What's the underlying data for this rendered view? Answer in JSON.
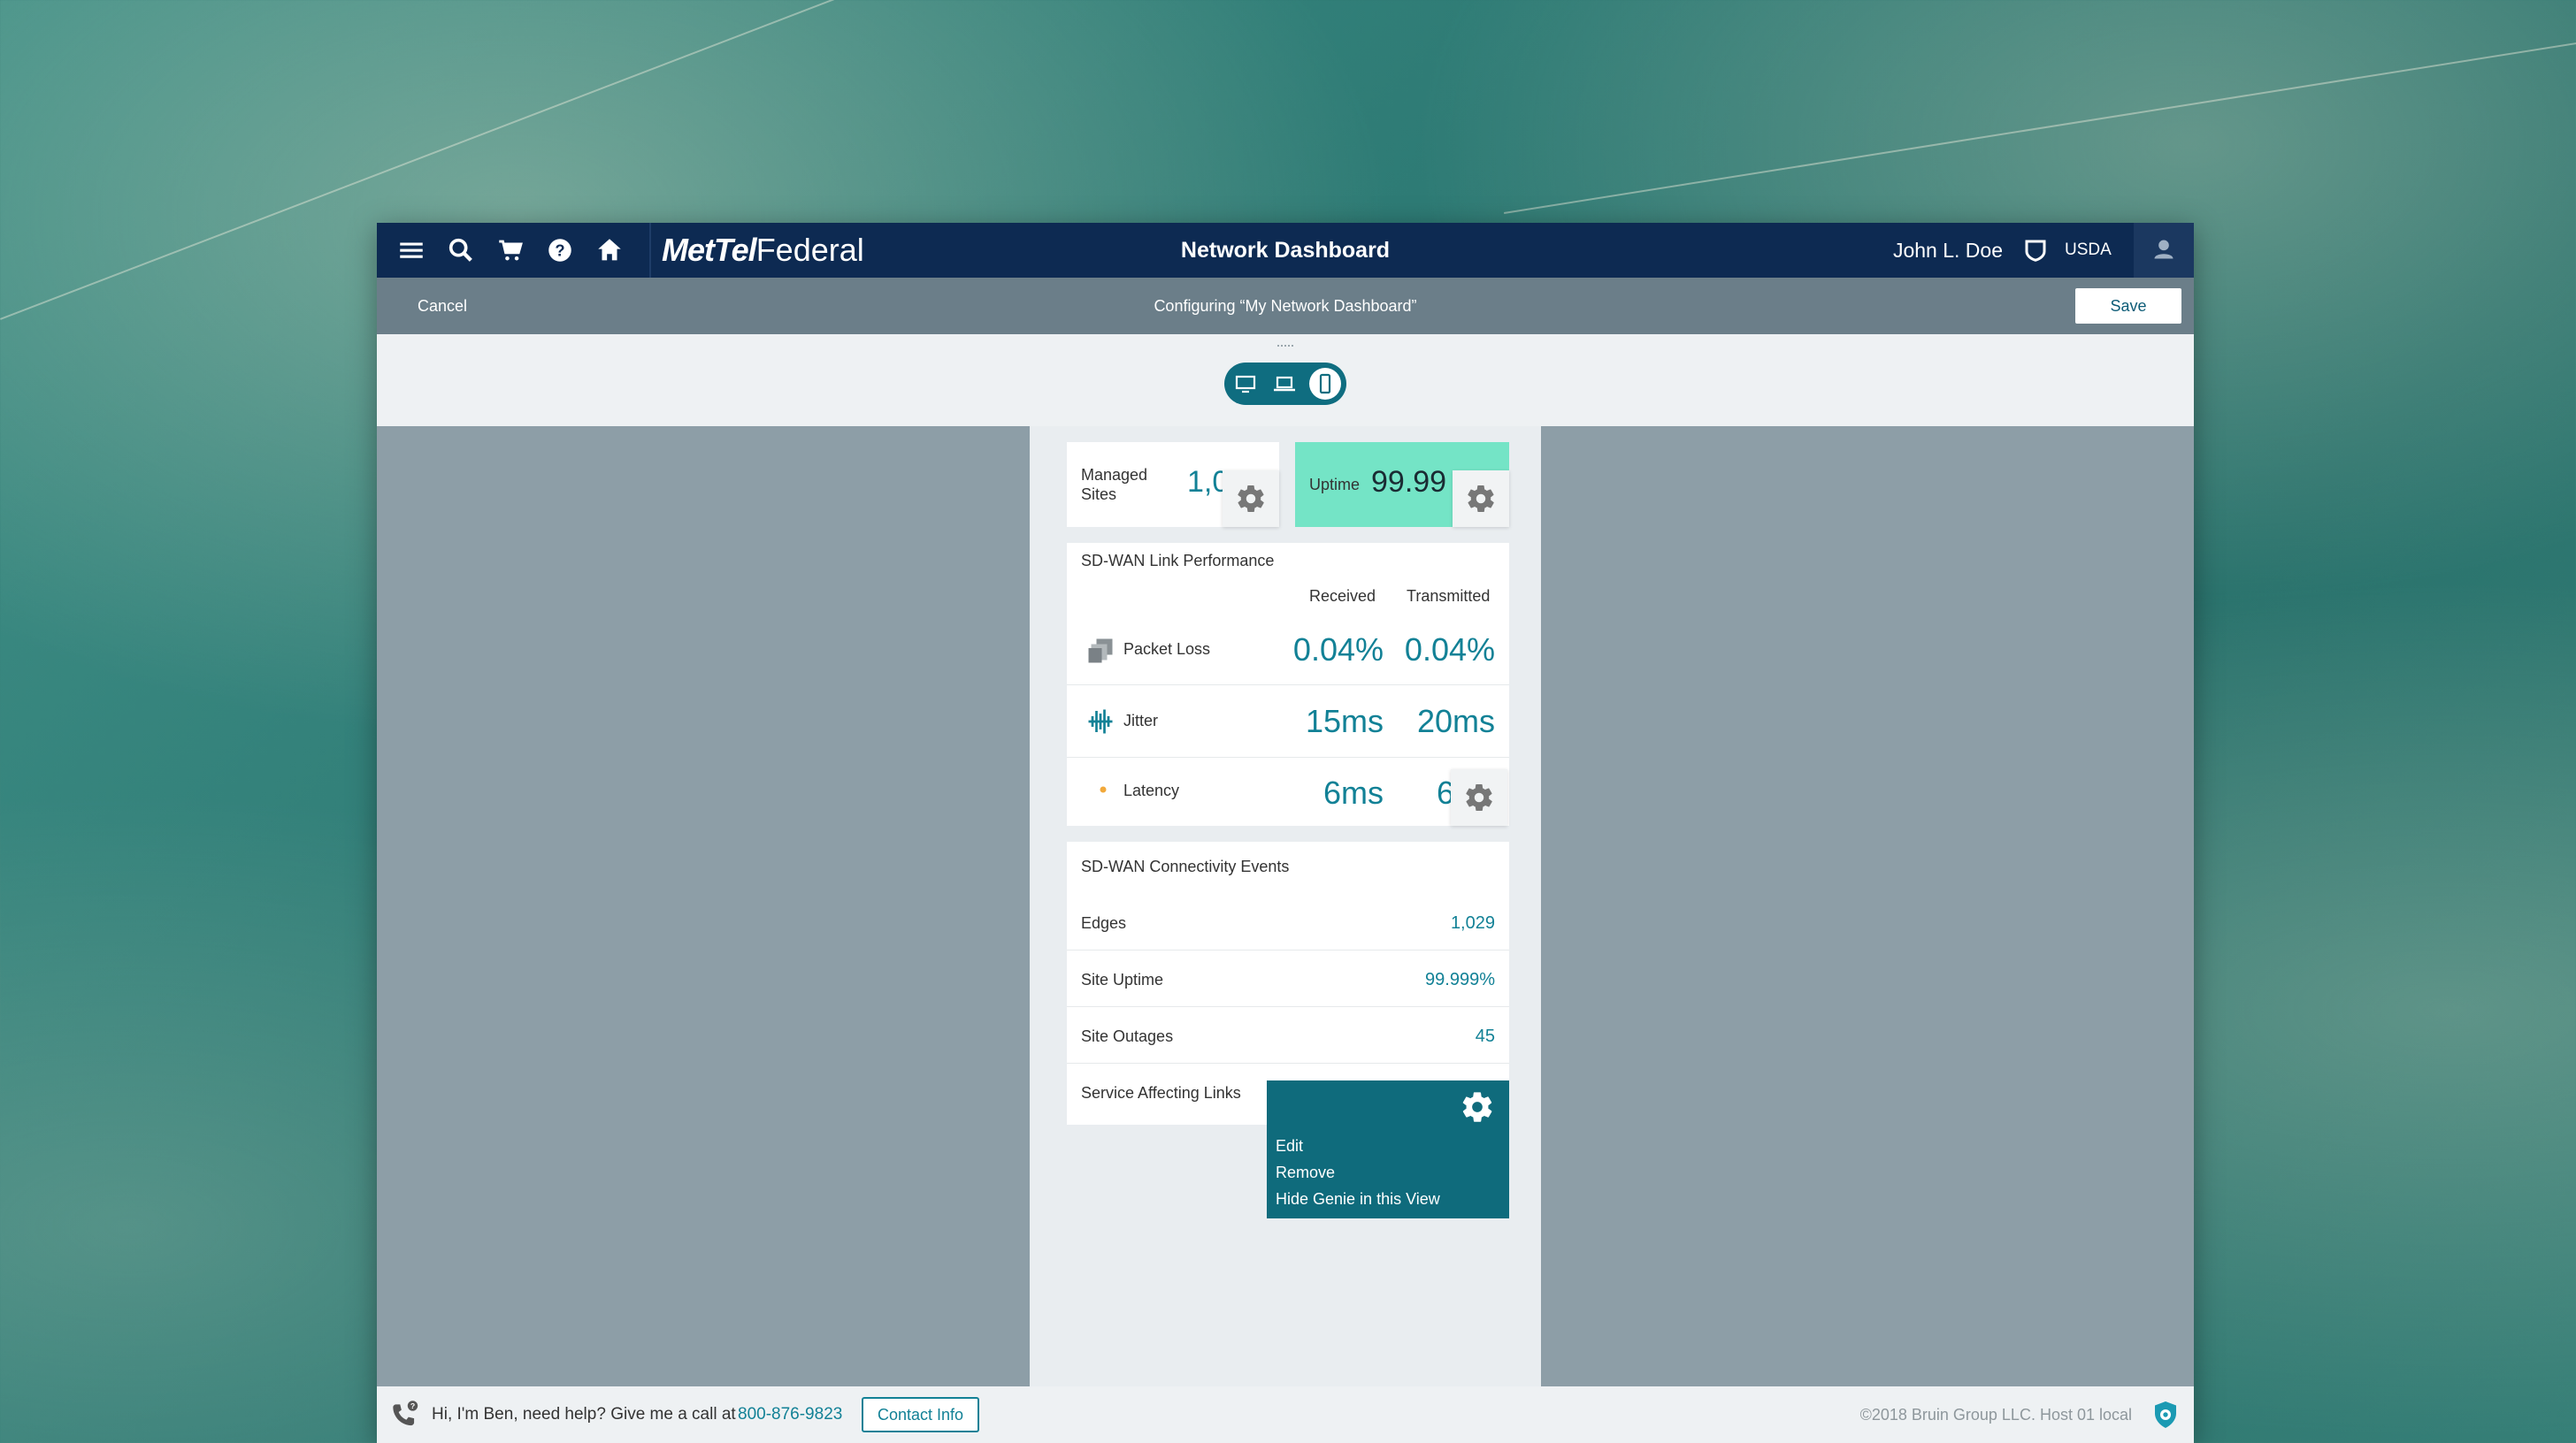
{
  "colors": {
    "nav_bg": "#0d2a52",
    "subbar_bg": "#6b7e89",
    "accent": "#128196",
    "uptime_bg": "#74e4c6",
    "menu_bg": "#0f6b7c"
  },
  "topbar": {
    "icons": [
      "menu-icon",
      "search-icon",
      "cart-icon",
      "help-icon",
      "home-icon"
    ],
    "logo_bold": "MetTel",
    "logo_light": "Federal",
    "title": "Network Dashboard",
    "user_name": "John L. Doe",
    "agency": "USDA"
  },
  "subbar": {
    "cancel_label": "Cancel",
    "configuring_text": "Configuring “My Network Dashboard”",
    "save_label": "Save"
  },
  "view_toggle": {
    "options": [
      "desktop",
      "laptop",
      "mobile"
    ],
    "selected": "mobile"
  },
  "kpis": {
    "managed_sites": {
      "label_line1": "Managed",
      "label_line2": "Sites",
      "value": "1,0"
    },
    "uptime": {
      "label": "Uptime",
      "value": "99.99"
    }
  },
  "link_performance": {
    "title": "SD-WAN Link Performance",
    "col_received": "Received",
    "col_transmitted": "Transmitted",
    "rows": [
      {
        "label": "Packet Loss",
        "received": "0.04%",
        "transmitted": "0.04%"
      },
      {
        "label": "Jitter",
        "received": "15ms",
        "transmitted": "20ms"
      },
      {
        "label": "Latency",
        "received": "6ms",
        "transmitted": "6"
      }
    ]
  },
  "connectivity": {
    "title": "SD-WAN Connectivity Events",
    "rows": [
      {
        "label": "Edges",
        "value": "1,029"
      },
      {
        "label": "Site Uptime",
        "value": "99.999%"
      },
      {
        "label": "Site Outages",
        "value": "45"
      },
      {
        "label": "Service Affecting Links",
        "value": ""
      }
    ]
  },
  "context_menu": {
    "items": [
      "Edit",
      "Remove",
      "Hide Genie in this View"
    ]
  },
  "footer": {
    "help_text": "Hi, I'm Ben, need help? Give me a call at",
    "phone": "800-876-9823",
    "contact_label": "Contact Info",
    "copyright": "©2018 Bruin Group LLC. Host 01 local"
  }
}
